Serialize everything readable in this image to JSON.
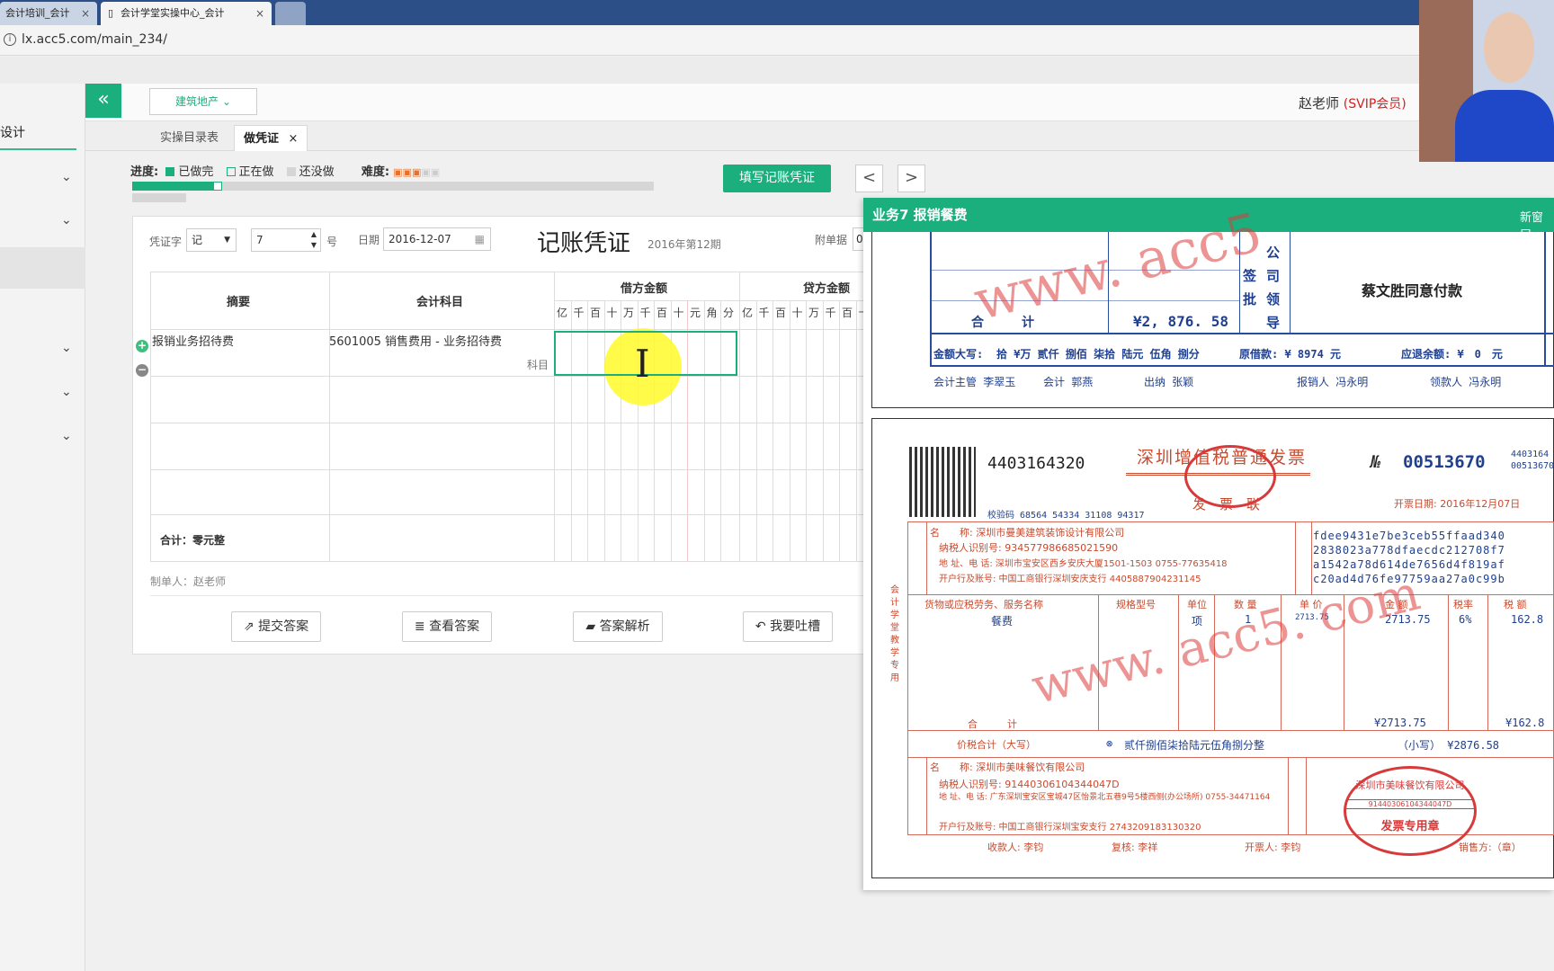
{
  "browser": {
    "tabs": [
      {
        "label": "会计培训_会计"
      },
      {
        "label": "会计学堂实操中心_会计"
      }
    ],
    "url": "lx.acc5.com/main_234/"
  },
  "sidebar": {
    "title": "设计"
  },
  "header": {
    "industry": "建筑地产",
    "user_name": "赵老师",
    "user_badge": "(SVIP会员)"
  },
  "subtabs": [
    {
      "label": "实操目录表"
    },
    {
      "label": "做凭证"
    }
  ],
  "progress": {
    "label": "进度:",
    "done_label": "已做完",
    "doing_label": "正在做",
    "todo_label": "还没做",
    "difficulty_label": "难度:",
    "difficulty_stars": 3,
    "difficulty_max": 5,
    "done_count": 9,
    "doing_index": 9,
    "total": 64
  },
  "toolbar": {
    "fill_label": "填写记账凭证",
    "prev": "<",
    "next": ">"
  },
  "voucher": {
    "word_label": "凭证字",
    "word_value": "记",
    "number_value": "7",
    "number_suffix": "号",
    "date_label": "日期",
    "date_value": "2016-12-07",
    "title": "记账凭证",
    "period": "2016年第12期",
    "attach_label": "附单据",
    "attach_value": "0",
    "col_summary": "摘要",
    "col_account": "会计科目",
    "col_debit": "借方金额",
    "col_credit": "贷方金额",
    "debit_digits": [
      "亿",
      "千",
      "百",
      "十",
      "万",
      "千",
      "百",
      "十",
      "元",
      "角",
      "分"
    ],
    "credit_digits": [
      "亿",
      "千",
      "百",
      "十",
      "万",
      "千",
      "百",
      "十"
    ],
    "row1_summary": "报销业务招待费",
    "row1_account": "5601005 销售费用 - 业务招待费",
    "row1_hint": "科目",
    "total": "合计：零元整",
    "maker": "制单人：赵老师"
  },
  "actions": {
    "submit": "提交答案",
    "view": "查看答案",
    "analysis": "答案解析",
    "feedback": "我要吐槽"
  },
  "popup": {
    "title": "业务7 报销餐费",
    "newwin": "新窗口",
    "slip": {
      "watermark": "www. acc5",
      "gong": "公",
      "si": "司",
      "qian": "签",
      "ling": "领",
      "pi": "批",
      "dao": "导",
      "approve": "蔡文胜同意付款",
      "total_label": "合　　　计",
      "total_value": "¥2, 876. 58",
      "amount_label": "金额大写:",
      "amount_words": "拾 ¥万 贰仟 捌佰 柒拾 陆元 伍角 捌分",
      "borrowed": "原借款: ¥ 8974 元",
      "refund": "应退余额: ¥　0　元",
      "supervisor": "会计主管 李翠玉",
      "accountant": "会计 郭燕",
      "cashier": "出纳 张颖",
      "reporter": "报销人 冯永明",
      "receiver": "领款人 冯永明"
    },
    "invoice": {
      "code": "4403164320",
      "title": "深圳增值税普通发票",
      "no_label": "№",
      "no": "00513670",
      "no_small_1": "4403164",
      "no_small_2": "00513670",
      "date": "开票日期: 2016年12月07日",
      "check": "校验码 68564 54334 31108 94317",
      "copy": "发　票　联",
      "buyer_name": "名　　称: 深圳市曼美建筑装饰设计有限公司",
      "buyer_tax": "纳税人识别号: 934577986685021590",
      "buyer_addr": "地 址、电 话: 深圳市宝安区西乡安庆大厦1501-1503 0755-77635418",
      "buyer_bank": "开户行及账号: 中国工商银行深圳安庆支行 4405887904231145",
      "cipher_1": "fdee9431e7be3ceb55ffaad340",
      "cipher_2": "2838023a778dfaecdc212708f7",
      "cipher_3": "a1542a78d614de7656d4f819af",
      "cipher_4": "c20ad4d76fe97759aa27a0c99b",
      "col_item": "货物或应税劳务、服务名称",
      "col_spec": "规格型号",
      "col_unit": "单位",
      "col_qty": "数 量",
      "col_price": "单 价",
      "col_amount": "金 额",
      "col_rate": "税率",
      "col_tax": "税 额",
      "item": "餐费",
      "unit": "项",
      "qty": "1",
      "price": "2713.75",
      "amount": "2713.75",
      "rate": "6%",
      "tax": "162.8",
      "sum_label": "合　　　计",
      "sum_amount": "¥2713.75",
      "sum_tax": "¥162.8",
      "total_label": "价税合计（大写）",
      "total_words": "贰仟捌佰柒拾陆元伍角捌分整",
      "total_small": "（小写） ¥2876.58",
      "watermark": "www. acc5. com",
      "seller_name": "名　　称: 深圳市美味餐饮有限公司",
      "seller_tax": "纳税人识别号: 91440306104344047D",
      "seller_addr": "地 址、电 话: 广东深圳宝安区宝城47区怡景北五巷9号5楼西侧(办公场所) 0755-34471164",
      "seller_bank": "开户行及账号: 中国工商银行深圳宝安支行 2743209183130320",
      "payee": "收款人: 李钧",
      "reviewer": "复核: 李祥",
      "issuer": "开票人: 李钧",
      "seller_seal": "销售方:（章）",
      "stamp_text": "深圳市美味餐饮有限公司",
      "stamp_code": "91440306104344047D",
      "stamp_label": "发票专用章",
      "side_text": "会计学堂教学专用"
    }
  },
  "colors": {
    "accent": "#1aaf7d",
    "red": "#d63a3a",
    "blue_ink": "#1f3f8f"
  }
}
